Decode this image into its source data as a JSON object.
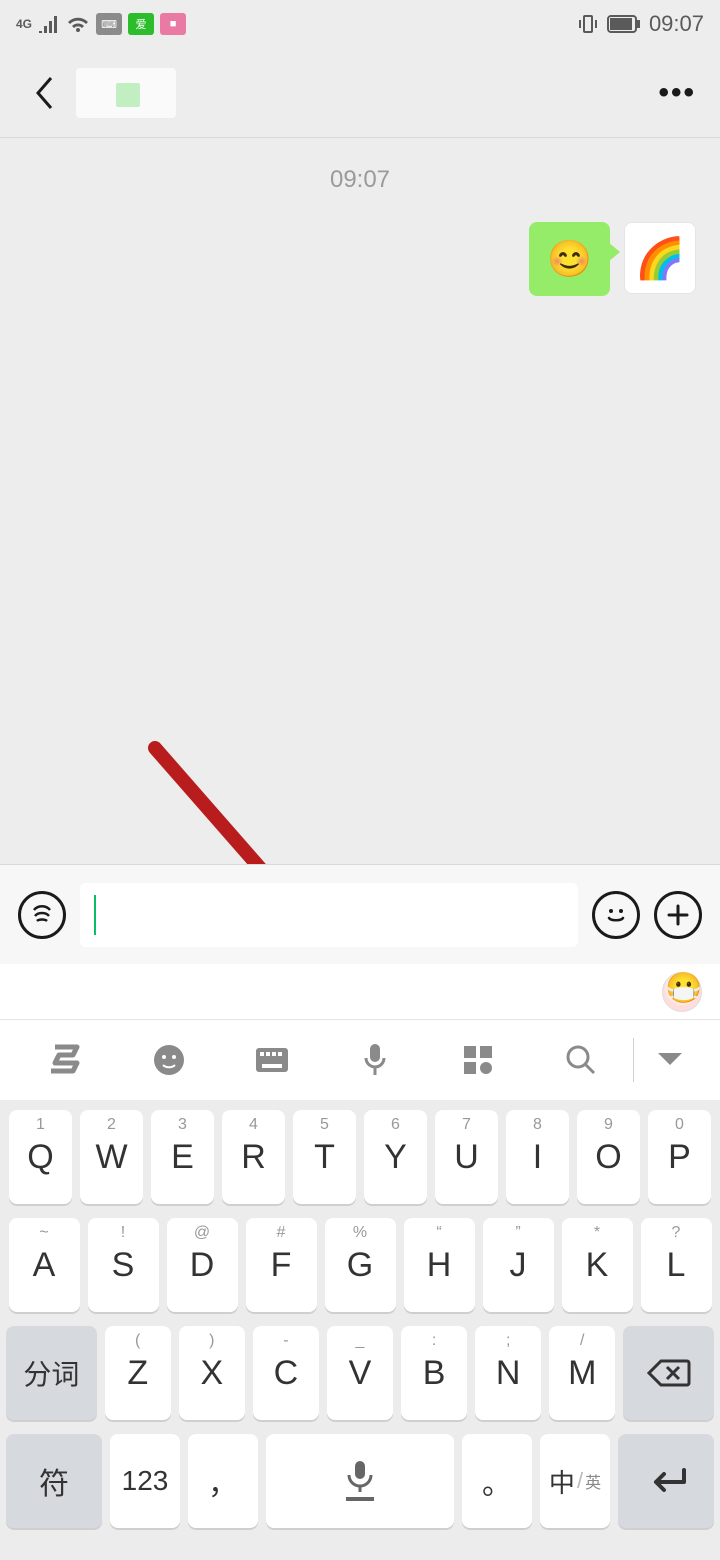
{
  "status": {
    "network": "4G",
    "time": "09:07"
  },
  "chat": {
    "timestamp": "09:07",
    "message_emoji": "😊",
    "avatar_emoji": "🌈"
  },
  "input": {
    "value": "",
    "placeholder": ""
  },
  "keyboard": {
    "row1": [
      {
        "main": "Q",
        "sub": "1"
      },
      {
        "main": "W",
        "sub": "2"
      },
      {
        "main": "E",
        "sub": "3"
      },
      {
        "main": "R",
        "sub": "4"
      },
      {
        "main": "T",
        "sub": "5"
      },
      {
        "main": "Y",
        "sub": "6"
      },
      {
        "main": "U",
        "sub": "7"
      },
      {
        "main": "I",
        "sub": "8"
      },
      {
        "main": "O",
        "sub": "9"
      },
      {
        "main": "P",
        "sub": "0"
      }
    ],
    "row2": [
      {
        "main": "A",
        "sub": "~"
      },
      {
        "main": "S",
        "sub": "!"
      },
      {
        "main": "D",
        "sub": "@"
      },
      {
        "main": "F",
        "sub": "#"
      },
      {
        "main": "G",
        "sub": "%"
      },
      {
        "main": "H",
        "sub": "“"
      },
      {
        "main": "J",
        "sub": "”"
      },
      {
        "main": "K",
        "sub": "*"
      },
      {
        "main": "L",
        "sub": "?"
      }
    ],
    "row3": {
      "split": "分词",
      "keys": [
        {
          "main": "Z",
          "sub": "("
        },
        {
          "main": "X",
          "sub": ")"
        },
        {
          "main": "C",
          "sub": "-"
        },
        {
          "main": "V",
          "sub": "_"
        },
        {
          "main": "B",
          "sub": ":"
        },
        {
          "main": "N",
          "sub": ";"
        },
        {
          "main": "M",
          "sub": "/"
        }
      ]
    },
    "row4": {
      "symbol": "符",
      "num": "123",
      "comma": "，",
      "period": "。",
      "lang_primary": "中",
      "lang_secondary": "英"
    }
  }
}
